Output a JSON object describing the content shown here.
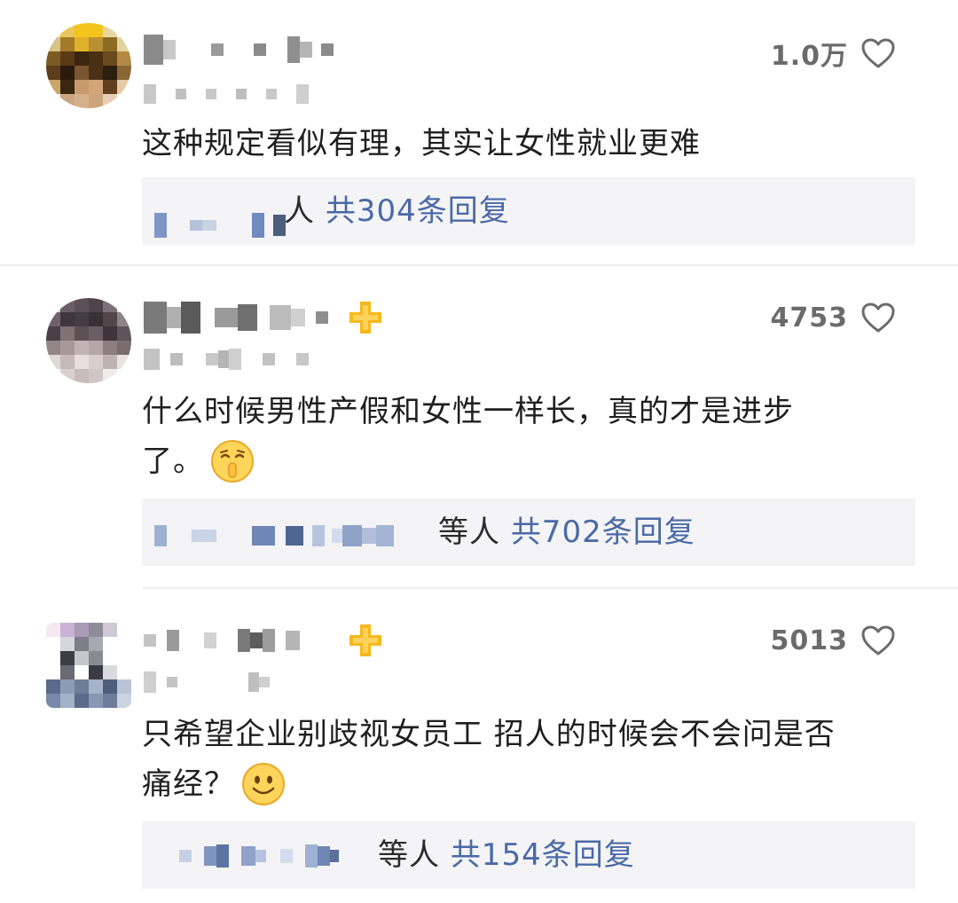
{
  "comments": [
    {
      "likes": "1.0万",
      "text_lines": [
        "这种规定看似有理，其实让女性就业更难"
      ],
      "reply_suffix": "人",
      "reply_link": "共304条回复",
      "emoji": ""
    },
    {
      "likes": "4753",
      "text_lines": [
        "什么时候男性产假和女性一样长，真的才是进步",
        "了。"
      ],
      "reply_suffix": "等人",
      "reply_link": "共702条回复",
      "emoji": "shush-face-icon"
    },
    {
      "likes": "5013",
      "text_lines": [
        "只希望企业别歧视女员工 招人的时候会不会问是否",
        "痛经？"
      ],
      "reply_suffix": "等人",
      "reply_link": "共154条回复",
      "emoji": "smile-face-icon"
    }
  ],
  "colors": {
    "reply_link": "#4a69a6",
    "like_count": "#6b6b6b",
    "reply_bg": "#f4f4f6",
    "badge": "#f6b81c"
  },
  "icons": {
    "like": "heart-outline-icon",
    "badge": "plus-badge-icon"
  }
}
